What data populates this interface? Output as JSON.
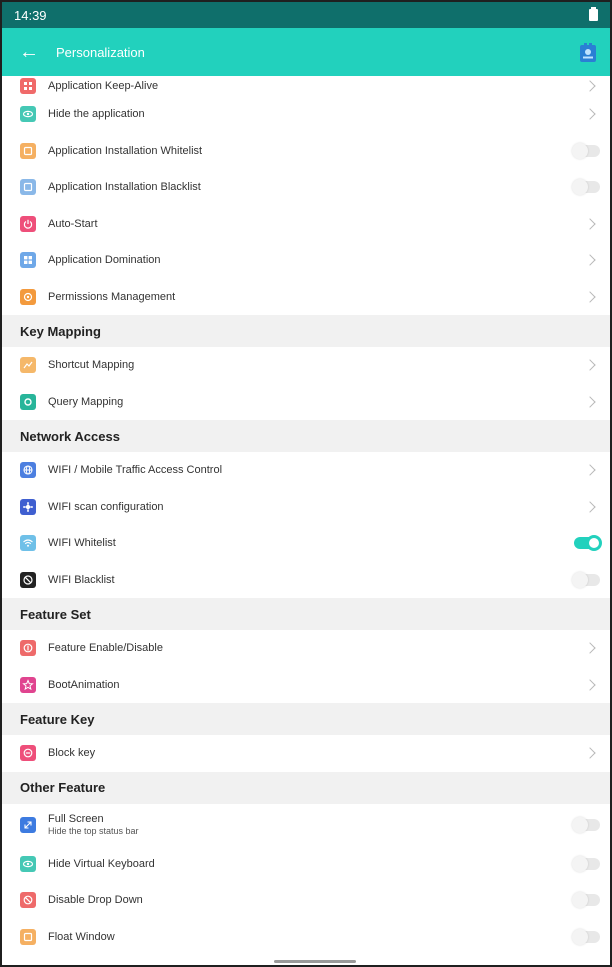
{
  "status": {
    "time": "14:39"
  },
  "appbar": {
    "title": "Personalization"
  },
  "colors": {
    "statusbar": "#0f6f6b",
    "appbar": "#22d1bd",
    "toggle_on": "#22d1bd"
  },
  "rows": [
    {
      "label": "Application Keep-Alive",
      "icon": "keep-alive-icon",
      "color": "#f06a6a",
      "control": "chevron"
    },
    {
      "label": "Hide the application",
      "icon": "hide-app-icon",
      "color": "#45c8b5",
      "control": "chevron"
    },
    {
      "label": "Application Installation Whitelist",
      "icon": "install-whitelist-icon",
      "color": "#f5b062",
      "control": "toggle",
      "on": false
    },
    {
      "label": "Application Installation Blacklist",
      "icon": "install-blacklist-icon",
      "color": "#8ab8e8",
      "control": "toggle",
      "on": false
    },
    {
      "label": "Auto-Start",
      "icon": "power-icon",
      "color": "#ee4f7a",
      "control": "chevron"
    },
    {
      "label": "Application Domination",
      "icon": "grid-icon",
      "color": "#6fa8e8",
      "control": "chevron"
    },
    {
      "label": "Permissions Management",
      "icon": "permission-icon",
      "color": "#f39a3d",
      "control": "chevron"
    }
  ],
  "key_mapping": {
    "header": "Key Mapping",
    "rows": [
      {
        "label": "Shortcut Mapping",
        "icon": "shortcut-icon",
        "color": "#f5b86a",
        "control": "chevron"
      },
      {
        "label": "Query Mapping",
        "icon": "query-icon",
        "color": "#28b59a",
        "control": "chevron"
      }
    ]
  },
  "network_access": {
    "header": "Network Access",
    "rows": [
      {
        "label": "WIFI / Mobile Traffic Access Control",
        "icon": "globe-icon",
        "color": "#4c7fe0",
        "control": "chevron"
      },
      {
        "label": "WIFI scan configuration",
        "icon": "scan-config-icon",
        "color": "#3f5fd0",
        "control": "chevron"
      },
      {
        "label": "WIFI Whitelist",
        "icon": "wifi-icon",
        "color": "#6fc0e8",
        "control": "toggle",
        "on": true
      },
      {
        "label": "WIFI Blacklist",
        "icon": "wifi-block-icon",
        "color": "#222222",
        "control": "toggle",
        "on": false
      }
    ]
  },
  "feature_set": {
    "header": "Feature Set",
    "rows": [
      {
        "label": "Feature Enable/Disable",
        "icon": "feature-toggle-icon",
        "color": "#ee6a6a",
        "control": "chevron"
      },
      {
        "label": "BootAnimation",
        "icon": "boot-animation-icon",
        "color": "#e0448f",
        "control": "chevron"
      }
    ]
  },
  "feature_key": {
    "header": "Feature Key",
    "rows": [
      {
        "label": "Block key",
        "icon": "block-key-icon",
        "color": "#ee4f7a",
        "control": "chevron"
      }
    ]
  },
  "other_feature": {
    "header": "Other Feature",
    "rows": [
      {
        "label": "Full Screen",
        "sublabel": "Hide the top status bar",
        "icon": "fullscreen-icon",
        "color": "#3d7be0",
        "control": "toggle",
        "on": false
      },
      {
        "label": "Hide Virtual Keyboard",
        "icon": "keyboard-icon",
        "color": "#45c8b5",
        "control": "toggle",
        "on": false
      },
      {
        "label": "Disable Drop Down",
        "icon": "dropdown-block-icon",
        "color": "#ee6a6a",
        "control": "toggle",
        "on": false
      },
      {
        "label": "Float Window",
        "icon": "float-window-icon",
        "color": "#f5b062",
        "control": "toggle",
        "on": false
      }
    ]
  }
}
